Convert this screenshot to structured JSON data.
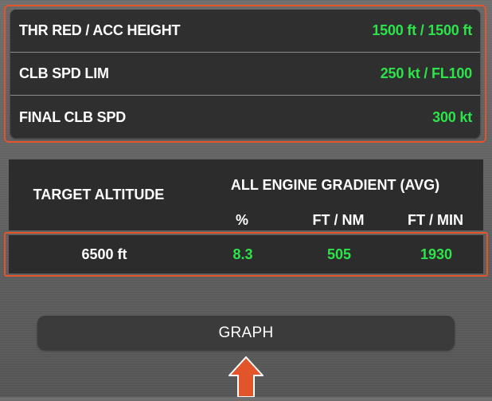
{
  "settings": [
    {
      "label": "THR RED / ACC HEIGHT",
      "value": "1500 ft / 1500 ft"
    },
    {
      "label": "CLB SPD LIM",
      "value": "250 kt / FL100"
    },
    {
      "label": "FINAL CLB SPD",
      "value": "300 kt"
    }
  ],
  "table": {
    "target_header": "TARGET ALTITUDE",
    "gradient_header": "ALL ENGINE GRADIENT (AVG)",
    "columns": [
      "%",
      "FT / NM",
      "FT / MIN"
    ],
    "row": {
      "altitude": "6500 ft",
      "percent": "8.3",
      "ft_nm": "505",
      "ft_min": "1930"
    }
  },
  "graph_button": {
    "label": "GRAPH"
  },
  "colors": {
    "accent": "#e2552a",
    "value_green": "#2ce44a",
    "panel": "#2c2c2c"
  },
  "icons": {
    "pointer": "up-arrow-icon"
  }
}
